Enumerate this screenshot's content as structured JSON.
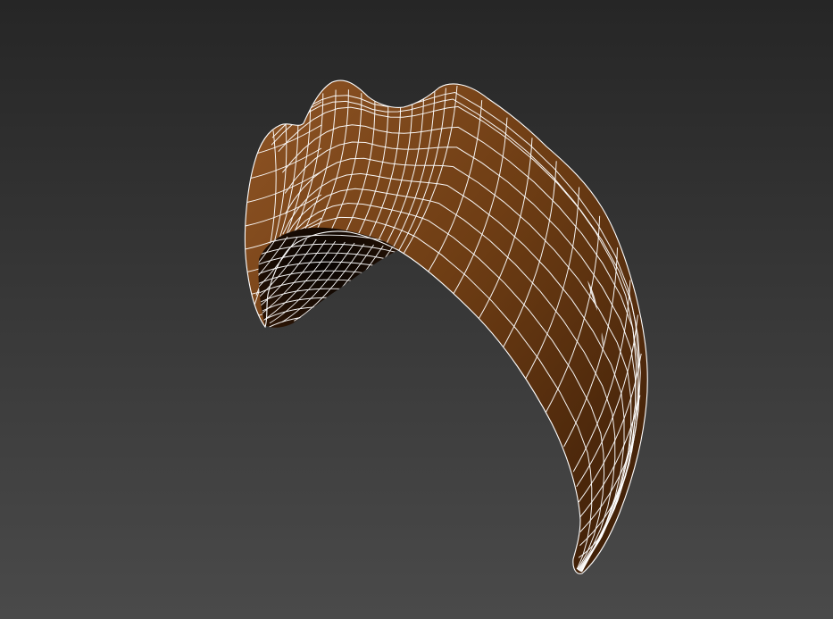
{
  "viewport": {
    "background_top": "#262626",
    "background_bottom": "#4a4a4a",
    "object": {
      "name": "claw-model",
      "shading": "wood-brown",
      "base_color": "#6e3d14",
      "highlight_color": "#8f5424",
      "shadow_color": "#3a1c06",
      "wireframe_color": "#ffffff",
      "wireframe_overlay": true
    }
  }
}
